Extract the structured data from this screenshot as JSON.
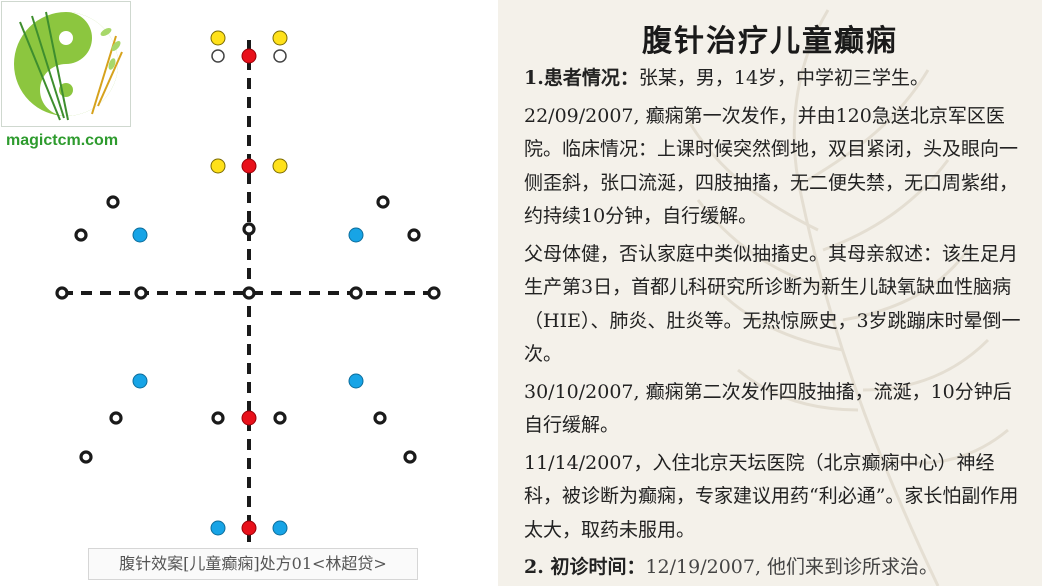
{
  "logo": {
    "alt": "yin-yang with acupuncture needles",
    "colors": {
      "green": "#8cc63f",
      "dark_green": "#3e8e2e",
      "gold": "#d6a21c"
    }
  },
  "brand": "magictcm.com",
  "diagram": {
    "caption": "腹针效案[儿童癫痫]处方01<林超贷>",
    "colors": {
      "red": "#e8101a",
      "yellow": "#ffe11a",
      "blue": "#17a4e6",
      "black": "#1a1a1a",
      "white": "#ffffff"
    }
  },
  "article": {
    "title": "腹针治疗儿童癫痫",
    "sections": [
      {
        "label": "1.患者情况",
        "sep": "：",
        "text": "张某，男，14岁，中学初三学生。"
      },
      {
        "text": "22/09/2007, 癫痫第一次发作，并由120急送北京军区医院。临床情况：上课时候突然倒地，双目紧闭，头及眼向一侧歪斜，张口流涎，四肢抽搐，无二便失禁，无口周紫绀，约持续10分钟，自行缓解。"
      },
      {
        "text": "父母体健，否认家庭中类似抽搐史。其母亲叙述：该生足月生产第3日，首都儿科研究所诊断为新生儿缺氧缺血性脑病（HIE）、肺炎、肚炎等。无热惊厥史，3岁跳蹦床时晕倒一次。"
      },
      {
        "text": " 30/10/2007, 癫痫第二次发作四肢抽搐，流涎，10分钟后自行缓解。"
      },
      {
        "text": "11/14/2007，入住北京天坛医院（北京癫痫中心）神经科，被诊断为癫痫，专家建议用药“利必通”。家长怕副作用太大，取药未服用。"
      },
      {
        "label": "2. 初诊时间",
        "sep": "：",
        "text": "12/19/2007,  他们来到诊所求治。"
      }
    ]
  }
}
